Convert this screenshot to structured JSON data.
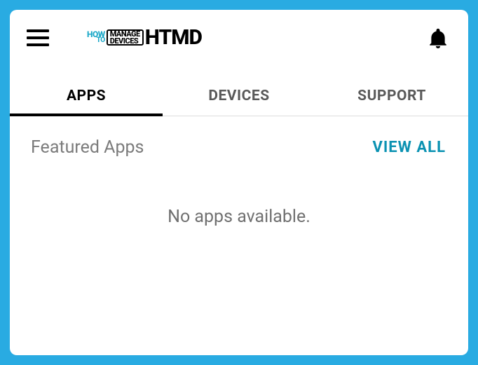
{
  "logo": {
    "how": "HOW",
    "to": "TO",
    "manage": "MANAGE",
    "devices": "DEVICES",
    "brand": "HTMD"
  },
  "tabs": {
    "apps": "APPS",
    "devices": "DEVICES",
    "support": "SUPPORT"
  },
  "section": {
    "title": "Featured Apps",
    "view_all": "VIEW ALL",
    "empty": "No apps available."
  }
}
